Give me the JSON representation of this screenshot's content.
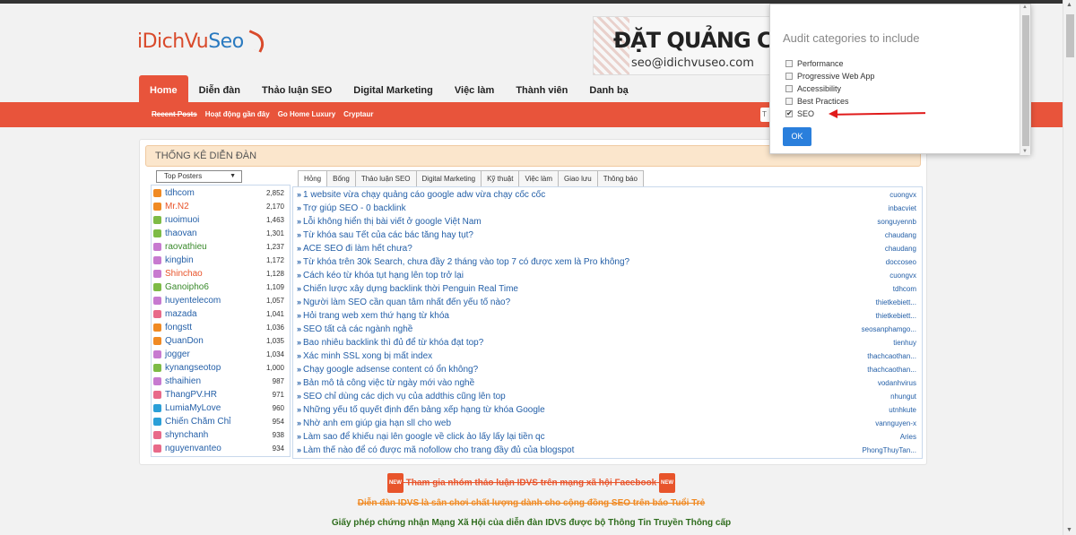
{
  "header": {
    "logo_main": "iDichVu",
    "logo_accent": "Seo",
    "banner_title": "ĐẶT QUẢNG CÁO",
    "banner_email": "seo@idichvuseo.com"
  },
  "nav": {
    "items": [
      "Home",
      "Diễn đàn",
      "Thảo luận SEO",
      "Digital Marketing",
      "Việc làm",
      "Thành viên",
      "Danh bạ"
    ]
  },
  "subnav": {
    "items": [
      "Recent Posts",
      "Hoạt động gần đây",
      "Go Home Luxury",
      "Cryptaur"
    ],
    "search_stub": "T"
  },
  "stats": {
    "title": "THỐNG KÊ DIỄN ĐÀN",
    "select_value": "Top Posters",
    "posters": [
      {
        "name": "tdhcom",
        "count": "2,852",
        "icon_color": "#f08a24",
        "name_color": "blue"
      },
      {
        "name": "Mr.N2",
        "count": "2,170",
        "icon_color": "#f08a24",
        "name_color": "orange"
      },
      {
        "name": "ruoimuoi",
        "count": "1,463",
        "icon_color": "#7dbb46",
        "name_color": "blue"
      },
      {
        "name": "thaovan",
        "count": "1,301",
        "icon_color": "#7dbb46",
        "name_color": "blue"
      },
      {
        "name": "raovathieu",
        "count": "1,237",
        "icon_color": "#c77ad0",
        "name_color": "green"
      },
      {
        "name": "kingbin",
        "count": "1,172",
        "icon_color": "#c77ad0",
        "name_color": "blue"
      },
      {
        "name": "Shinchao",
        "count": "1,128",
        "icon_color": "#c77ad0",
        "name_color": "orange"
      },
      {
        "name": "Ganoipho6",
        "count": "1,109",
        "icon_color": "#7dbb46",
        "name_color": "green"
      },
      {
        "name": "huyentelecom",
        "count": "1,057",
        "icon_color": "#c77ad0",
        "name_color": "blue"
      },
      {
        "name": "mazada",
        "count": "1,041",
        "icon_color": "#e86a8a",
        "name_color": "blue"
      },
      {
        "name": "fongstt",
        "count": "1,036",
        "icon_color": "#f08a24",
        "name_color": "blue"
      },
      {
        "name": "QuanDon",
        "count": "1,035",
        "icon_color": "#f08a24",
        "name_color": "blue"
      },
      {
        "name": "jogger",
        "count": "1,034",
        "icon_color": "#c77ad0",
        "name_color": "blue"
      },
      {
        "name": "kynangseotop",
        "count": "1,000",
        "icon_color": "#7dbb46",
        "name_color": "blue"
      },
      {
        "name": "sthaihien",
        "count": "987",
        "icon_color": "#c77ad0",
        "name_color": "blue"
      },
      {
        "name": "ThangPV.HR",
        "count": "971",
        "icon_color": "#e86a8a",
        "name_color": "blue"
      },
      {
        "name": "LumiaMyLove",
        "count": "960",
        "icon_color": "#2a9fd8",
        "name_color": "blue"
      },
      {
        "name": "Chiến Chăm Chỉ",
        "count": "954",
        "icon_color": "#2a9fd8",
        "name_color": "blue"
      },
      {
        "name": "shynchanh",
        "count": "938",
        "icon_color": "#e86a8a",
        "name_color": "blue"
      },
      {
        "name": "nguyenvanteo",
        "count": "934",
        "icon_color": "#e86a8a",
        "name_color": "blue"
      }
    ],
    "tabs": [
      "Hỏng",
      "Bống",
      "Thảo luận SEO",
      "Digital Marketing",
      "Kỹ thuật",
      "Việc làm",
      "Giao lưu",
      "Thông báo"
    ],
    "threads": [
      {
        "title": "1 website vừa chạy quảng cáo google adw vừa chạy cốc cốc",
        "author": "cuongvx"
      },
      {
        "title": "Trợ giúp SEO - 0 backlink",
        "author": "inbacviet"
      },
      {
        "title": "Lỗi không hiển thị bài viết ở google Việt Nam",
        "author": "songuyennb"
      },
      {
        "title": "Từ khóa sau Tết của các bác tăng hay tụt?",
        "author": "chaudang"
      },
      {
        "title": "ACE SEO đi làm hết chưa?",
        "author": "chaudang"
      },
      {
        "title": "Từ khóa trên 30k Search, chưa đầy 2 tháng vào top 7 có được xem là Pro không?",
        "author": "doccoseo"
      },
      {
        "title": "Cách kéo từ khóa tụt hạng lên top trở lại",
        "author": "cuongvx"
      },
      {
        "title": "Chiến lược xây dựng backlink thời Penguin Real Time",
        "author": "tdhcom"
      },
      {
        "title": "Người làm SEO cần quan tâm nhất đến yếu tố nào?",
        "author": "thietkebiett..."
      },
      {
        "title": "Hỏi trang web xem thứ hạng từ khóa",
        "author": "thietkebiett..."
      },
      {
        "title": "SEO tất cả các ngành nghề",
        "author": "seosanphamgo..."
      },
      {
        "title": "Bao nhiêu backlink thì đủ để từ khóa đạt top?",
        "author": "tienhuy"
      },
      {
        "title": "Xác minh SSL xong bị mất index",
        "author": "thachcaothan..."
      },
      {
        "title": "Chạy google adsense content có ổn không?",
        "author": "thachcaothan..."
      },
      {
        "title": "Bản mô tả công việc từ ngày mới vào nghề",
        "author": "vodanhvirus"
      },
      {
        "title": "SEO chỉ dùng các dịch vụ của addthis cũng lên top",
        "author": "nhungut"
      },
      {
        "title": "Những yếu tố quyết định đến bảng xếp hạng từ khóa Google",
        "author": "utnhkute"
      },
      {
        "title": "Nhờ anh em giúp gia hạn sll cho web",
        "author": "vannguyen-x"
      },
      {
        "title": "Làm sao để khiếu nại lên google về click ảo lấy lấy lại tiền qc",
        "author": "Aries"
      },
      {
        "title": "Làm thế nào để có được mã nofollow cho trang đầy đủ của blogspot",
        "author": "PhongThuyTan..."
      }
    ]
  },
  "footer": {
    "line1": "Tham gia nhóm thảo luận IDVS trên mạng xã hội Facebook",
    "line2": "Diễn đàn IDVS là sân chơi chất lượng dành cho cộng đồng SEO trên báo Tuổi Trẻ",
    "line3": "Giấy phép chứng nhận Mạng Xã Hội của diễn đàn IDVS được bộ Thông Tin Truyền Thông cấp",
    "new_badge": "NEW"
  },
  "audit_popup": {
    "title": "Audit categories to include",
    "options": [
      {
        "label": "Performance",
        "checked": false
      },
      {
        "label": "Progressive Web App",
        "checked": false
      },
      {
        "label": "Accessibility",
        "checked": false
      },
      {
        "label": "Best Practices",
        "checked": false
      },
      {
        "label": "SEO",
        "checked": true
      }
    ],
    "ok_label": "OK"
  },
  "colors": {
    "accent": "#e8543b",
    "link": "#2560a8",
    "ok_button": "#2a7fdc",
    "annotation_arrow": "#e01b1b"
  }
}
